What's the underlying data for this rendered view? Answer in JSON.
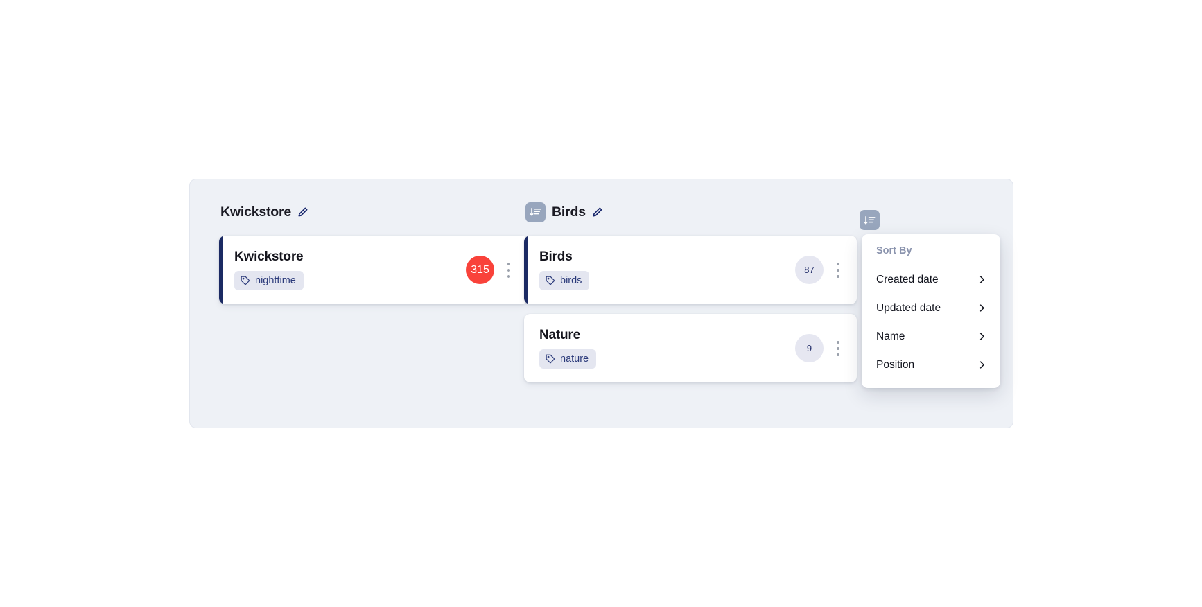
{
  "colors": {
    "board_bg": "#eef1f6",
    "card_accent": "#1b2a63",
    "count_red": "#f9423a",
    "count_soft_bg": "#e6e7f1",
    "tag_bg": "#e4e6f0",
    "tag_text": "#2b3a7a",
    "icon_btn_bg": "#98a6bd"
  },
  "columns": [
    {
      "title": "Kwickstore",
      "has_sort_icon": false,
      "sort_icon": "",
      "edit_icon": "pencil-icon",
      "cards": [
        {
          "title": "Kwickstore",
          "tag": "nighttime",
          "tag_icon": "tag-icon",
          "count": "315",
          "count_style": "red",
          "accent": true,
          "menu_icon": "kebab-menu-icon"
        }
      ]
    },
    {
      "title": "Birds",
      "has_sort_icon": true,
      "sort_icon": "sort-descending-icon",
      "edit_icon": "pencil-icon",
      "cards": [
        {
          "title": "Birds",
          "tag": "birds",
          "tag_icon": "tag-icon",
          "count": "87",
          "count_style": "soft",
          "accent": true,
          "menu_icon": "kebab-menu-icon"
        },
        {
          "title": "Nature",
          "tag": "nature",
          "tag_icon": "tag-icon",
          "count": "9",
          "count_style": "soft",
          "accent": false,
          "menu_icon": "kebab-menu-icon"
        }
      ]
    }
  ],
  "sort_trigger": {
    "icon": "sort-descending-icon"
  },
  "menu": {
    "label": "Sort By",
    "items": [
      {
        "label": "Created date",
        "chevron": "chevron-right-icon"
      },
      {
        "label": "Updated date",
        "chevron": "chevron-right-icon"
      },
      {
        "label": "Name",
        "chevron": "chevron-right-icon"
      },
      {
        "label": "Position",
        "chevron": "chevron-right-icon"
      }
    ]
  }
}
